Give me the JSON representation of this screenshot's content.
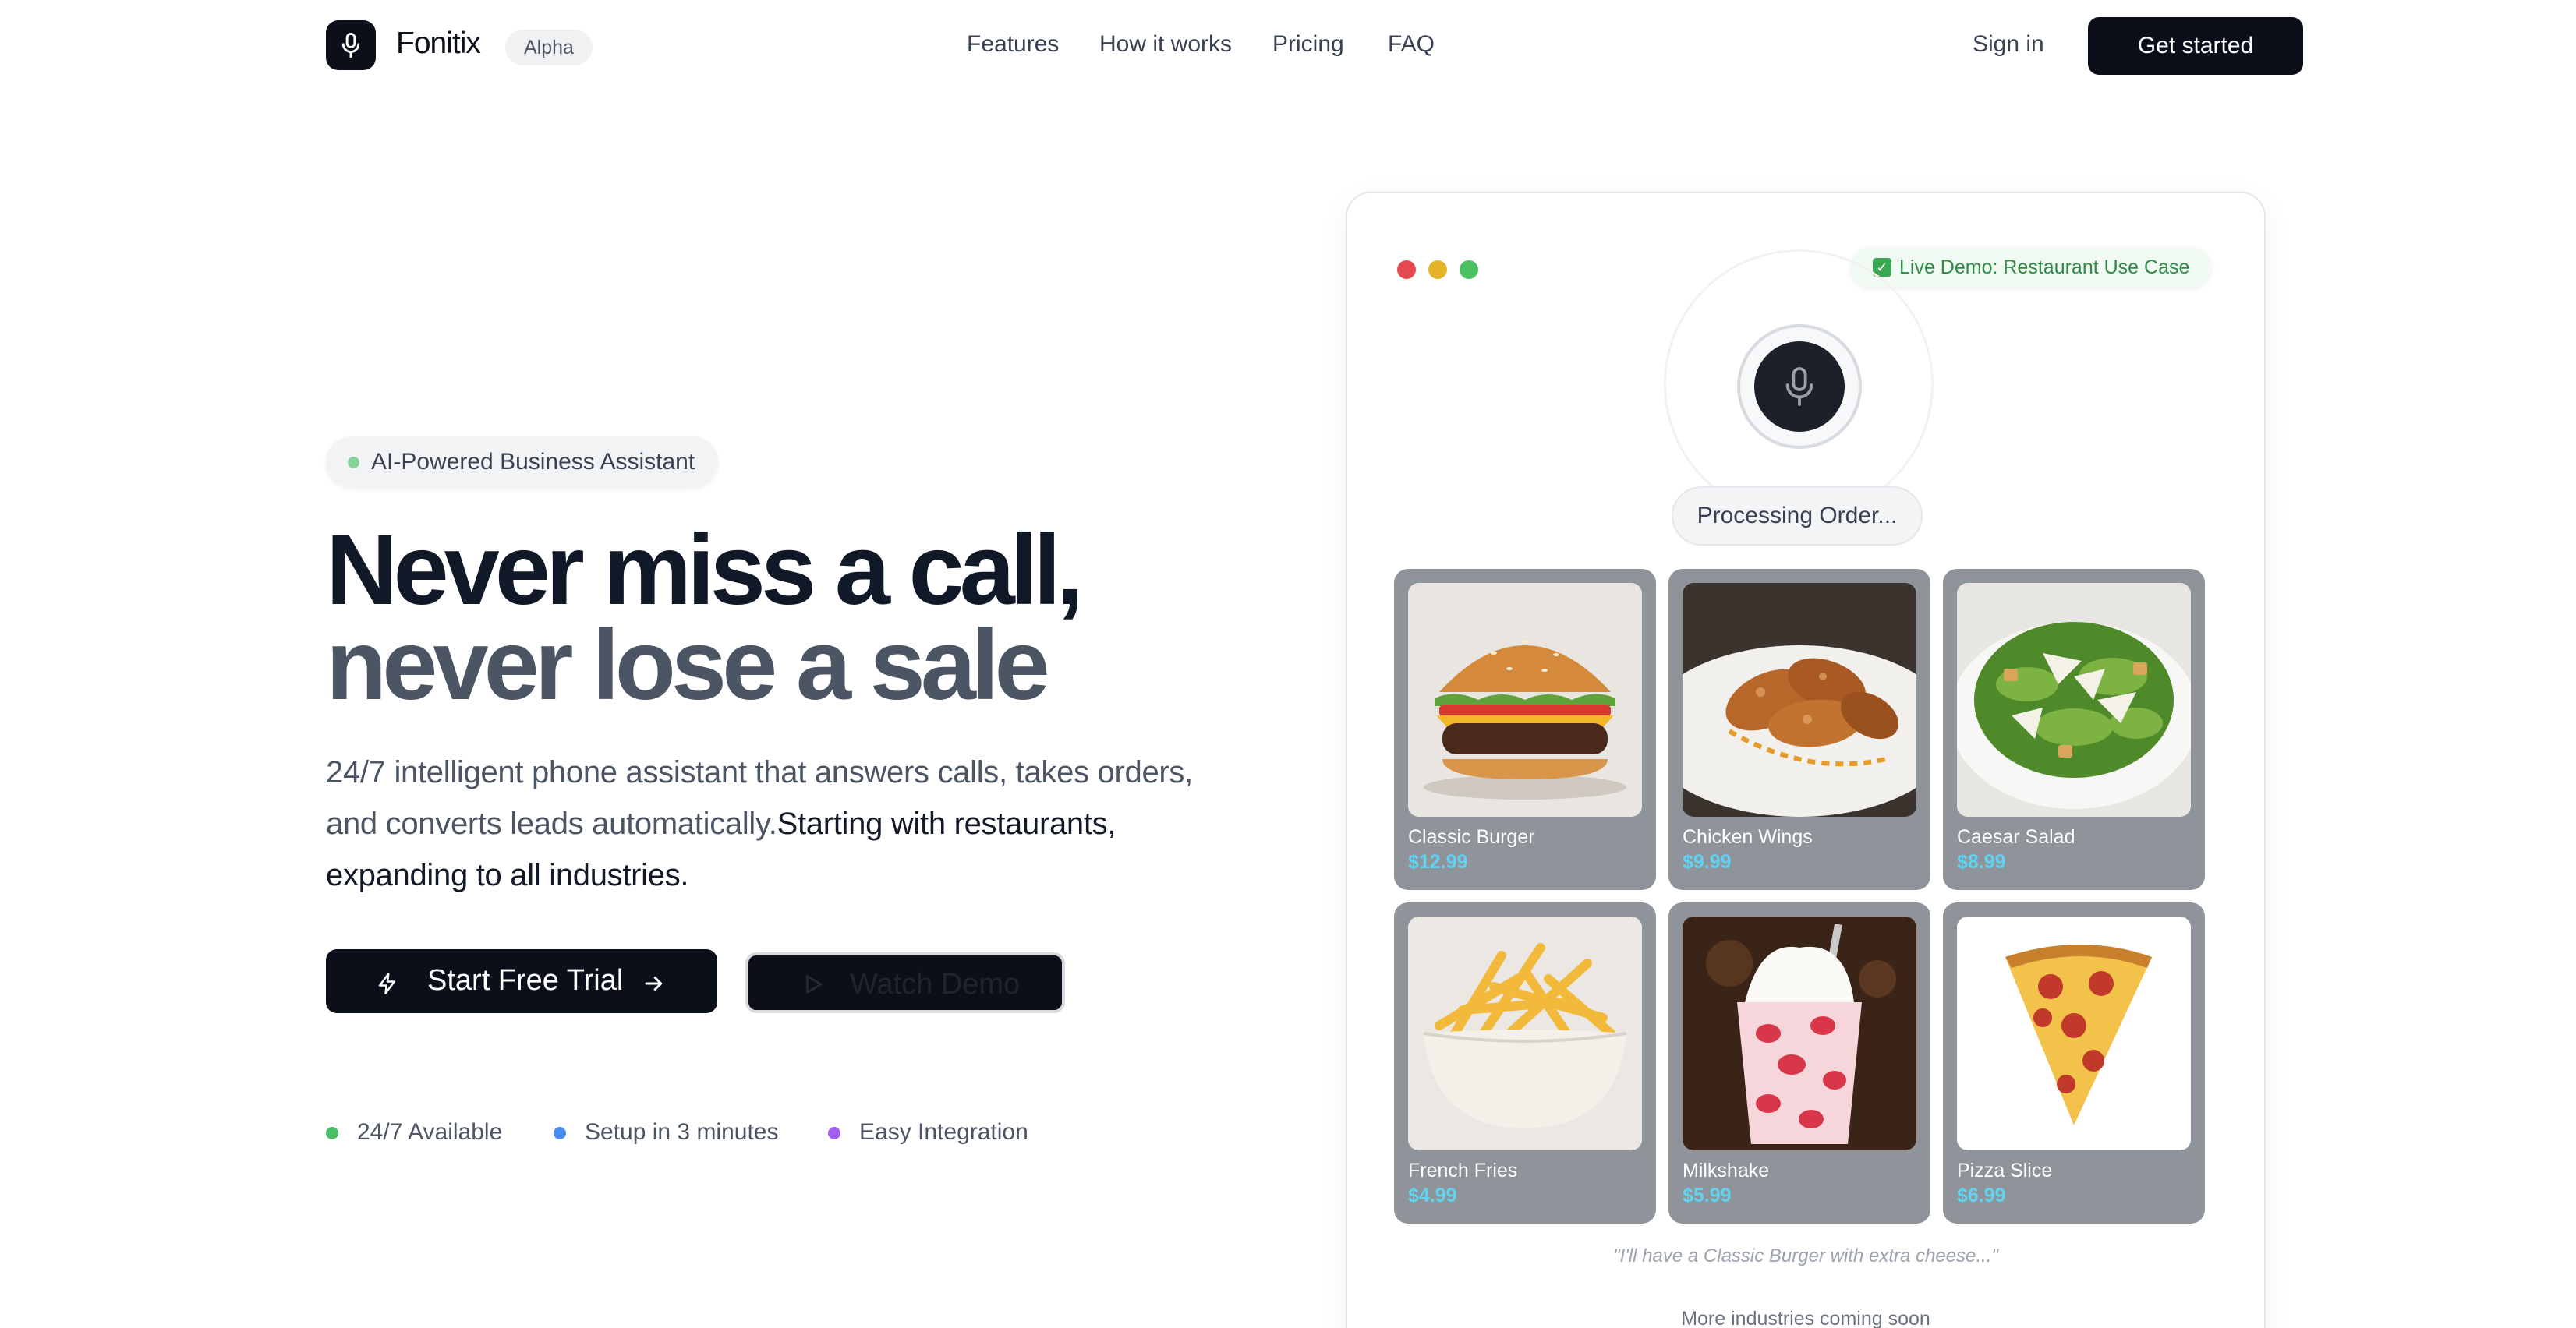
{
  "brand": {
    "name": "Fonitix",
    "tag": "Alpha"
  },
  "nav": {
    "links": [
      "Features",
      "How it works",
      "Pricing",
      "FAQ"
    ],
    "sign_in": "Sign in",
    "get_started": "Get started"
  },
  "hero": {
    "badge": "AI-Powered Business Assistant",
    "title_line1": "Never miss a call,",
    "title_line2": "never lose a sale",
    "lead_plain": "24/7 intelligent phone assistant that answers calls, takes orders, and converts leads automatically.",
    "lead_bold": "Starting with restaurants, expanding to all industries.",
    "cta_primary": "Start Free Trial",
    "cta_secondary": "Watch Demo",
    "features": [
      {
        "label": "24/7 Available",
        "color": "#4cbf68"
      },
      {
        "label": "Setup in 3 minutes",
        "color": "#4a8ff0"
      },
      {
        "label": "Easy Integration",
        "color": "#a45ff2"
      }
    ]
  },
  "demo": {
    "live_badge": "Live Demo: Restaurant Use Case",
    "status": "Processing Order...",
    "items": [
      {
        "name": "Classic Burger",
        "price": "$12.99",
        "icon": "burger-icon"
      },
      {
        "name": "Chicken Wings",
        "price": "$9.99",
        "icon": "chicken-wings-icon"
      },
      {
        "name": "Caesar Salad",
        "price": "$8.99",
        "icon": "salad-icon"
      },
      {
        "name": "French Fries",
        "price": "$4.99",
        "icon": "fries-icon"
      },
      {
        "name": "Milkshake",
        "price": "$5.99",
        "icon": "milkshake-icon"
      },
      {
        "name": "Pizza Slice",
        "price": "$6.99",
        "icon": "pizza-icon"
      }
    ],
    "quote": "\"I'll have a Classic Burger with extra cheese...\"",
    "more": "More industries coming soon"
  },
  "colors": {
    "dark": "#0b0f19",
    "accent_price": "#5fd3f0",
    "live_green": "#2f8a45"
  }
}
